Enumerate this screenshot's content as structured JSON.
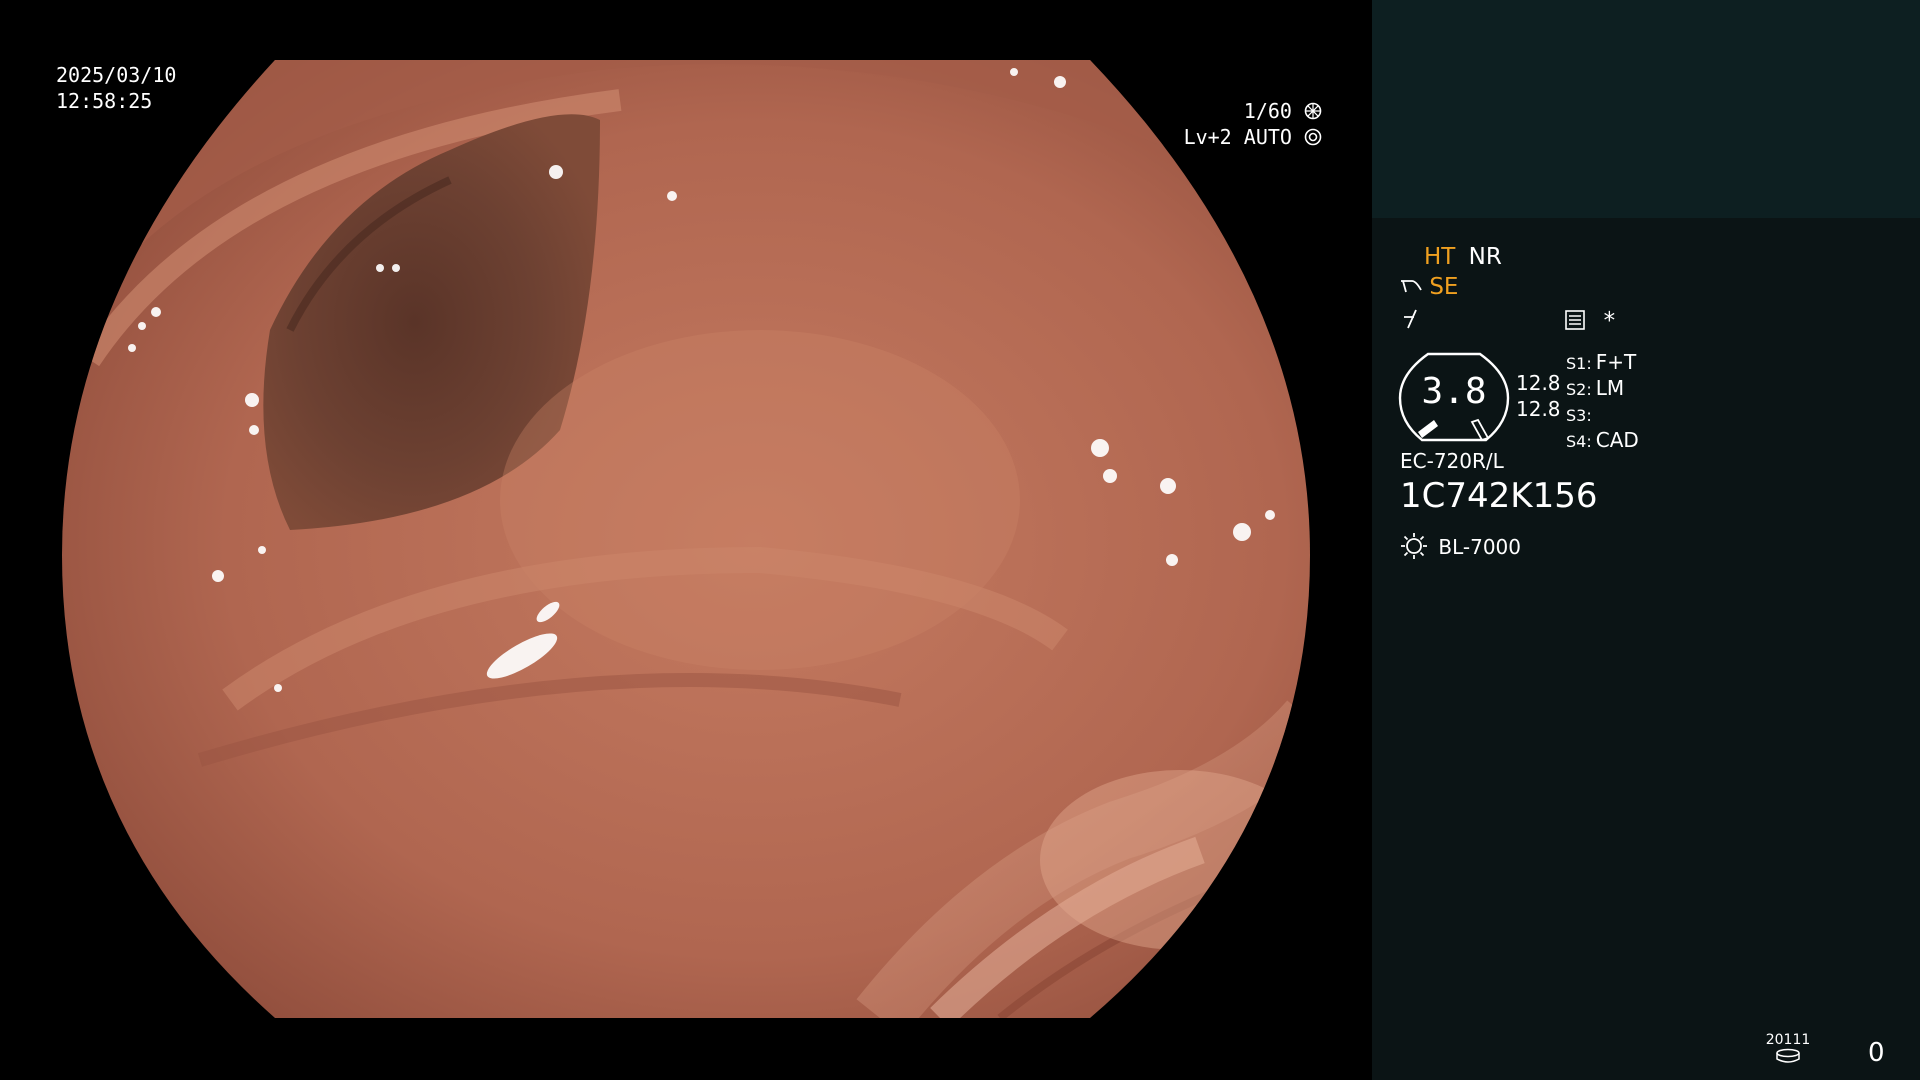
{
  "overlay": {
    "date": "2025/03/10",
    "time": "12:58:25",
    "shutter": "1/60",
    "iris": "Lv+2",
    "iris_mode": "AUTO"
  },
  "panel": {
    "ht": "HT",
    "nr": "NR",
    "se": "SE",
    "asterisk": "*",
    "gauge_value": "3.8",
    "diam_1": "12.8",
    "diam_2": "12.8",
    "s1_key": "S1:",
    "s1_val": "F+T",
    "s2_key": "S2:",
    "s2_val": "LM",
    "s3_key": "S3:",
    "s3_val": "",
    "s4_key": "S4:",
    "s4_val": "CAD",
    "scope_model": "EC-720R/L",
    "serial": "1C742K156",
    "light_source": "BL-7000",
    "storage_code": "20111",
    "count": "0"
  },
  "colors": {
    "accent_orange": "#f0a020",
    "panel_bg": "#0b1415",
    "panel_top_bg": "#0d1f21",
    "mucosa": "#b46a54"
  },
  "icons": [
    "aperture-icon",
    "iris-auto-icon",
    "scope-tip-icon",
    "signal-icon",
    "memo-icon",
    "light-source-icon",
    "disk-icon"
  ]
}
